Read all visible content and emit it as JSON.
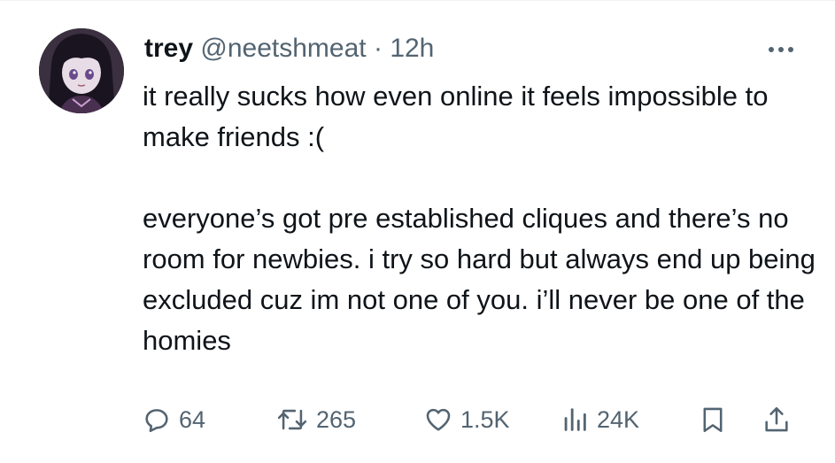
{
  "tweet": {
    "display_name": "trey",
    "handle": "@neetshmeat",
    "separator": "·",
    "time": "12h",
    "paragraphs": [
      "it really sucks how even online it feels impossible to make friends :(",
      "everyone’s got pre established cliques and there’s no room for newbies. i try so hard but always end up being excluded cuz im not one of you. i’ll never be one of the homies"
    ]
  },
  "actions": {
    "replies": "64",
    "reposts": "265",
    "likes": "1.5K",
    "views": "24K"
  },
  "icons": {
    "reply": "reply-icon",
    "repost": "repost-icon",
    "like": "heart-icon",
    "views": "views-icon",
    "bookmark": "bookmark-icon",
    "share": "share-icon",
    "more": "more-icon"
  },
  "colors": {
    "text": "#0f1419",
    "secondary": "#536471",
    "background": "#ffffff"
  }
}
